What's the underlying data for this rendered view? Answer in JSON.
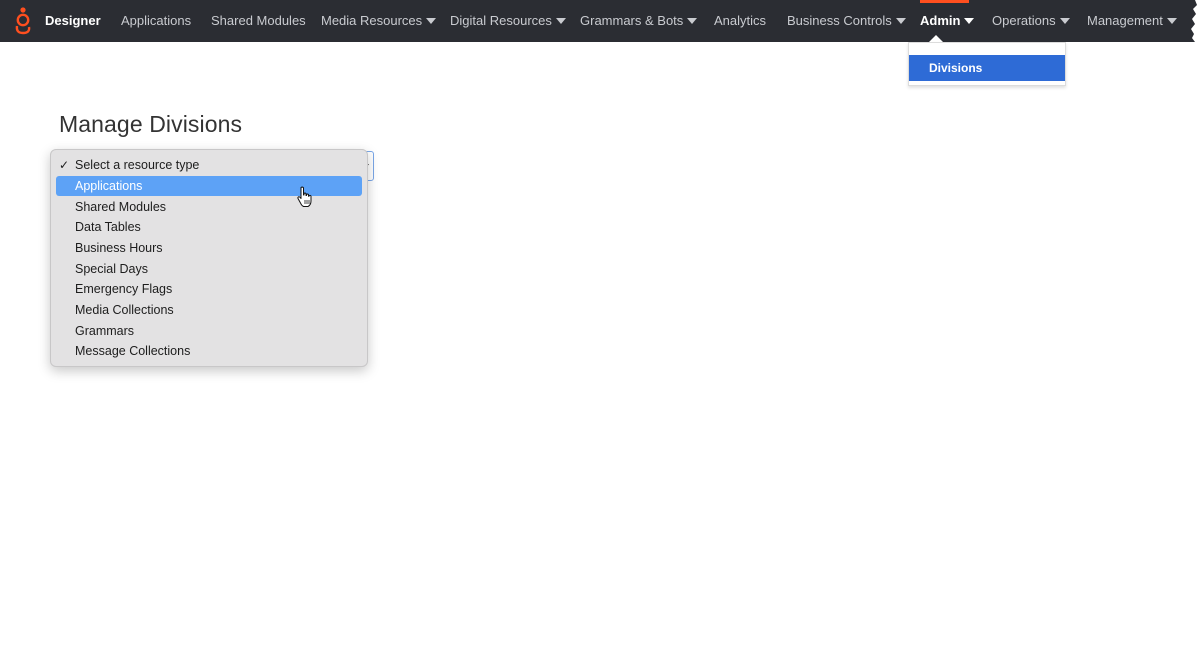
{
  "app": {
    "brand": "Designer",
    "accent_color": "#ff4f1f",
    "navbar_color": "#2b2d33"
  },
  "nav": {
    "items": [
      {
        "label": "Applications",
        "has_caret": false
      },
      {
        "label": "Shared Modules",
        "has_caret": false
      },
      {
        "label": "Media Resources",
        "has_caret": true
      },
      {
        "label": "Digital Resources",
        "has_caret": true
      },
      {
        "label": "Grammars & Bots",
        "has_caret": true
      },
      {
        "label": "Analytics",
        "has_caret": false
      },
      {
        "label": "Business Controls",
        "has_caret": true
      },
      {
        "label": "Admin",
        "has_caret": true,
        "active": true
      },
      {
        "label": "Operations",
        "has_caret": true
      },
      {
        "label": "Management",
        "has_caret": true
      }
    ]
  },
  "admin_menu": {
    "items": [
      {
        "label": "Divisions",
        "highlighted": true
      }
    ]
  },
  "page": {
    "title": "Manage Divisions"
  },
  "resource_type_select": {
    "selected": "Select a resource type",
    "highlighted": "Applications",
    "options": [
      "Select a resource type",
      "Applications",
      "Shared Modules",
      "Data Tables",
      "Business Hours",
      "Special Days",
      "Emergency Flags",
      "Media Collections",
      "Grammars",
      "Message Collections"
    ],
    "highlight_color": "#5da2f6"
  }
}
